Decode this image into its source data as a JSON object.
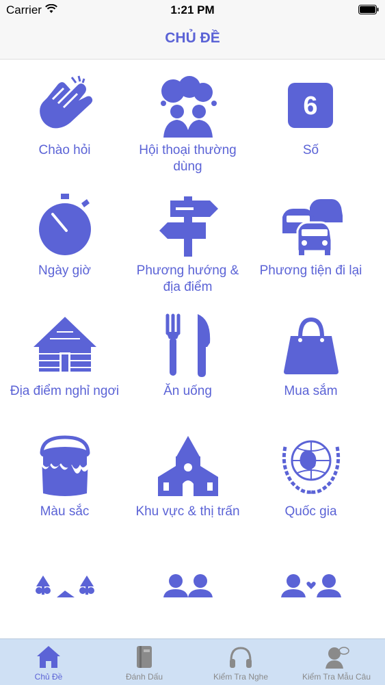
{
  "status_bar": {
    "carrier": "Carrier",
    "time": "1:21 PM"
  },
  "nav": {
    "title": "CHỦ ĐỀ"
  },
  "colors": {
    "accent": "#5b63d6",
    "tab_bar_bg": "#cfe0f4",
    "inactive_tab": "#8a8a8a"
  },
  "topics": [
    {
      "label": "Chào hỏi",
      "icon": "clapping-hands-icon",
      "number": ""
    },
    {
      "label": "Hội thoại thường dùng",
      "icon": "conversation-people-icon",
      "number": ""
    },
    {
      "label": "Số",
      "icon": "number-icon",
      "number": "6"
    },
    {
      "label": "Ngày giờ",
      "icon": "stopwatch-icon",
      "number": ""
    },
    {
      "label": "Phương hướng & địa điểm",
      "icon": "signpost-icon",
      "number": ""
    },
    {
      "label": "Phương tiện đi lại",
      "icon": "cars-icon",
      "number": ""
    },
    {
      "label": "Địa điểm nghỉ ngơi",
      "icon": "cabin-icon",
      "number": ""
    },
    {
      "label": "Ăn uống",
      "icon": "fork-knife-icon",
      "number": ""
    },
    {
      "label": "Mua sắm",
      "icon": "shopping-bag-icon",
      "number": ""
    },
    {
      "label": "Màu sắc",
      "icon": "paint-bucket-icon",
      "number": ""
    },
    {
      "label": "Khu vực & thị trấn",
      "icon": "church-icon",
      "number": ""
    },
    {
      "label": "Quốc gia",
      "icon": "united-nations-icon",
      "number": ""
    },
    {
      "label": "",
      "icon": "landscape-icon",
      "number": ""
    },
    {
      "label": "",
      "icon": "two-people-icon",
      "number": ""
    },
    {
      "label": "",
      "icon": "couple-heart-icon",
      "number": ""
    }
  ],
  "tabs": [
    {
      "label": "Chủ Đề",
      "icon": "home-icon",
      "active": true
    },
    {
      "label": "Đánh Dấu",
      "icon": "book-icon",
      "active": false
    },
    {
      "label": "Kiểm Tra Nghe",
      "icon": "headphones-icon",
      "active": false
    },
    {
      "label": "Kiểm Tra Mẫu Câu",
      "icon": "speaking-person-icon",
      "active": false
    }
  ]
}
